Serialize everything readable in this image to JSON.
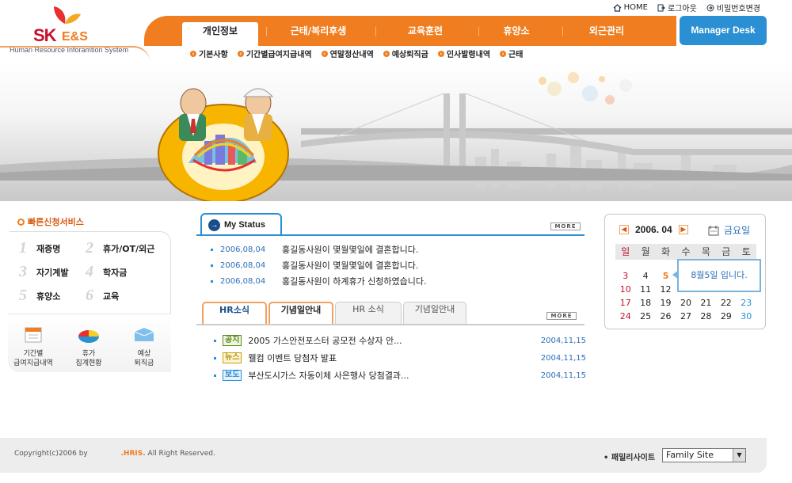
{
  "logo": {
    "brand": "SK",
    "brand2": "E&S",
    "subtitle": "Human Resource Inforamtion System"
  },
  "top_links": [
    {
      "label": "HOME",
      "icon": "home-icon"
    },
    {
      "label": "로그아웃",
      "icon": "logout-icon"
    },
    {
      "label": "비밀번호변경",
      "icon": "password-icon"
    }
  ],
  "nav": {
    "tabs": [
      "개인정보",
      "근태/복리후생",
      "교육훈련",
      "휴양소",
      "외근관리"
    ],
    "manager_desk": "Manager Desk"
  },
  "subnav": [
    "기본사항",
    "기간별급여지급내역",
    "연말정산내역",
    "예상퇴직금",
    "인사발령내역",
    "근태"
  ],
  "quick_service": {
    "title": "빠른신청서비스",
    "items": [
      {
        "num": "1",
        "label": "재증명"
      },
      {
        "num": "2",
        "label": "휴가/OT/외근"
      },
      {
        "num": "3",
        "label": "자기계발"
      },
      {
        "num": "4",
        "label": "학자금"
      },
      {
        "num": "5",
        "label": "휴양소"
      },
      {
        "num": "6",
        "label": "교육"
      }
    ],
    "icons": [
      {
        "line1": "기간별",
        "line2": "급여지급내역"
      },
      {
        "line1": "휴가",
        "line2": "집계현황"
      },
      {
        "line1": "예상",
        "line2": "퇴직금"
      }
    ]
  },
  "status": {
    "title": "My Status",
    "more": "MORE",
    "rows": [
      {
        "date": "2006,08,04",
        "text": "홍길동사원이 몇월몇일에 결혼합니다."
      },
      {
        "date": "2006,08,04",
        "text": "홍길동사원이 몇월몇일에 결혼합니다."
      },
      {
        "date": "2006,08,04",
        "text": "홍길동사원이  하계휴가 신청하였습니다."
      }
    ]
  },
  "hr": {
    "tabs": [
      "HR소식",
      "기념일안내",
      "HR 소식",
      "기념일안내"
    ],
    "more": "MORE",
    "rows": [
      {
        "badge": "공지",
        "badge_color": "#5a8a1a",
        "title": "2005 가스안전포스터 공모전 수상자 안...",
        "date": "2004,11,15"
      },
      {
        "badge": "뉴스",
        "badge_color": "#c8a000",
        "title": "웰컴 이벤트 당첨자 발표",
        "date": "2004,11,15"
      },
      {
        "badge": "보도",
        "badge_color": "#2a8fd3",
        "title": "부산도시가스 자동이체 사은행사 당첨결과...",
        "date": "2004,11,15"
      }
    ]
  },
  "calendar": {
    "month": "2006.  04",
    "weekday_today": "금요일",
    "weekdays": [
      "일",
      "월",
      "화",
      "수",
      "목",
      "금",
      "토"
    ],
    "weeks": [
      [
        "3",
        "4",
        "5",
        "",
        "",
        "",
        ""
      ],
      [
        "10",
        "11",
        "12",
        "",
        "",
        "",
        ""
      ],
      [
        "17",
        "18",
        "19",
        "20",
        "21",
        "22",
        "23"
      ],
      [
        "24",
        "25",
        "26",
        "27",
        "28",
        "29",
        "30"
      ]
    ],
    "tooltip": "8월5일 입니다.",
    "sunday_color": "#c8102e",
    "saturday_color": "#2a8fd3",
    "highlight_color": "#f07e20"
  },
  "footer": {
    "copyright_prefix": "Copyright(c)2006 by",
    "hris": ".HRIS.",
    "rights": "All Right Reserved.",
    "family_label": "• 패밀리사이트",
    "family_value": "Family Site"
  }
}
